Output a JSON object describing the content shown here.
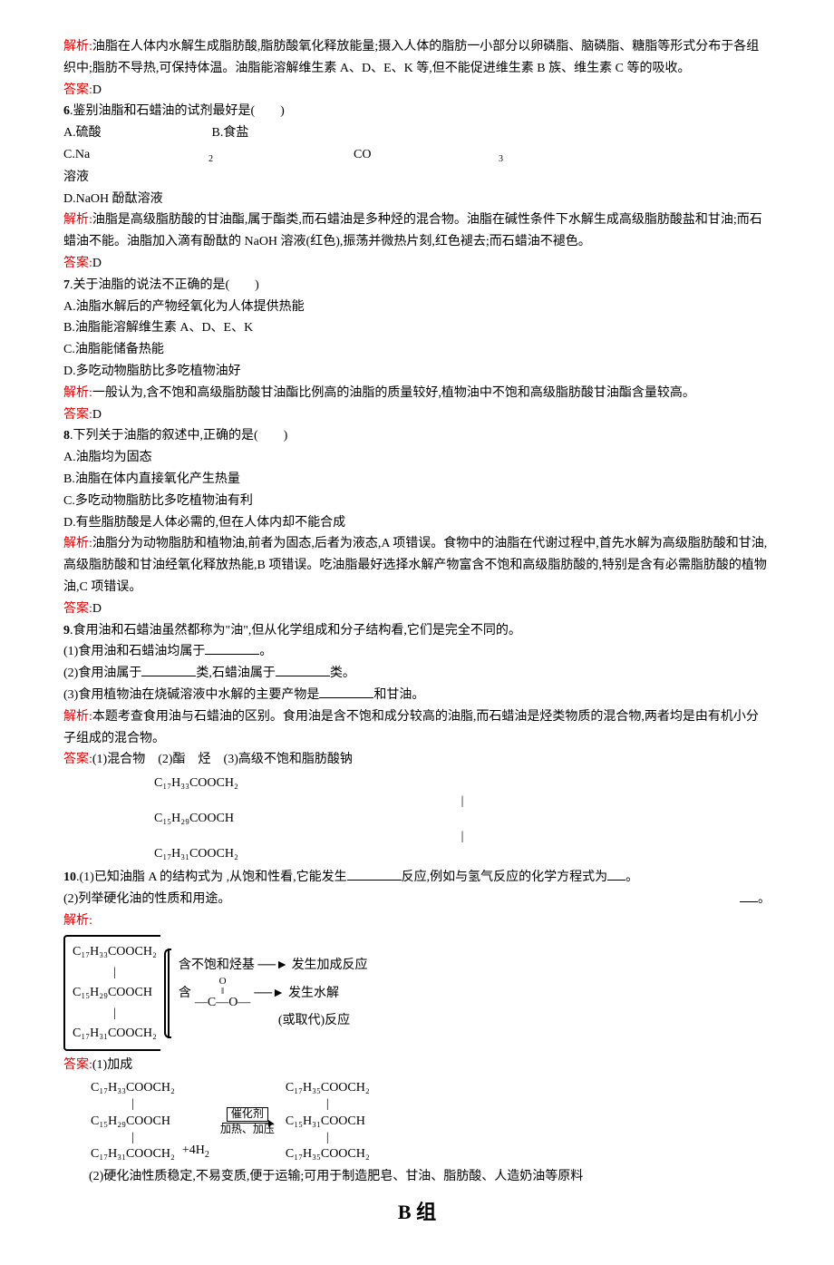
{
  "q5": {
    "jiexi_label": "解析:",
    "jiexi": "油脂在人体内水解生成脂肪酸,脂肪酸氧化释放能量;摄入人体的脂肪一小部分以卵磷脂、脑磷脂、糖脂等形式分布于各组织中;脂肪不导热,可保持体温。油脂能溶解维生素 A、D、E、K 等,但不能促进维生素 B 族、维生素 C 等的吸收。",
    "daan_label": "答案:",
    "daan": "D"
  },
  "q6": {
    "num": "6",
    "stem": ".鉴别油脂和石蜡油的试剂最好是(　　)",
    "optA": "A.硫酸",
    "optB": "B.食盐",
    "optC_pre": "C.Na",
    "optC_sub1": "2",
    "optC_mid": "CO",
    "optC_sub2": "3",
    "optC_post": "溶液",
    "optD": "D.NaOH 酚酞溶液",
    "jiexi_label": "解析:",
    "jiexi": "油脂是高级脂肪酸的甘油酯,属于酯类,而石蜡油是多种烃的混合物。油脂在碱性条件下水解生成高级脂肪酸盐和甘油;而石蜡油不能。油脂加入滴有酚酞的 NaOH 溶液(红色),振荡并微热片刻,红色褪去;而石蜡油不褪色。",
    "daan_label": "答案:",
    "daan": "D"
  },
  "q7": {
    "num": "7",
    "stem": ".关于油脂的说法不正确的是(　　)",
    "optA": "A.油脂水解后的产物经氧化为人体提供热能",
    "optB": "B.油脂能溶解维生素 A、D、E、K",
    "optC": "C.油脂能储备热能",
    "optD": "D.多吃动物脂肪比多吃植物油好",
    "jiexi_label": "解析:",
    "jiexi": "一般认为,含不饱和高级脂肪酸甘油酯比例高的油脂的质量较好,植物油中不饱和高级脂肪酸甘油酯含量较高。",
    "daan_label": "答案:",
    "daan": "D"
  },
  "q8": {
    "num": "8",
    "stem": ".下列关于油脂的叙述中,正确的是(　　)",
    "optA": "A.油脂均为固态",
    "optB": "B.油脂在体内直接氧化产生热量",
    "optC": "C.多吃动物脂肪比多吃植物油有利",
    "optD": "D.有些脂肪酸是人体必需的,但在人体内却不能合成",
    "jiexi_label": "解析:",
    "jiexi": "油脂分为动物脂肪和植物油,前者为固态,后者为液态,A 项错误。食物中的油脂在代谢过程中,首先水解为高级脂肪酸和甘油,高级脂肪酸和甘油经氧化释放热能,B 项错误。吃油脂最好选择水解产物富含不饱和高级脂肪酸的,特别是含有必需脂肪酸的植物油,C 项错误。",
    "daan_label": "答案:",
    "daan": "D"
  },
  "q9": {
    "num": "9",
    "stem": ".食用油和石蜡油虽然都称为\"油\",但从化学组成和分子结构看,它们是完全不同的。",
    "p1a": "(1)食用油和石蜡油均属于",
    "p1b": "。",
    "p2a": "(2)食用油属于",
    "p2b": "类,石蜡油属于",
    "p2c": "类。",
    "p3a": "(3)食用植物油在烧碱溶液中水解的主要产物是",
    "p3b": "和甘油。",
    "jiexi_label": "解析:",
    "jiexi": "本题考查食用油与石蜡油的区别。食用油是含不饱和成分较高的油脂,而石蜡油是烃类物质的混合物,两者均是由有机小分子组成的混合物。",
    "daan_label": "答案:",
    "daan": "(1)混合物　(2)酯　烃　(3)高级不饱和脂肪酸钠"
  },
  "q10": {
    "num": "10",
    "f1": "C₁₇H₃₃COOCH₂",
    "f2": "C₁₅H₂₉COOCH",
    "f3": "C₁₇H₃₁COOCH₂",
    "p1a": ".(1)已知油脂 A 的结构式为",
    "p1b": ",从饱和性看,它能发生",
    "p1c": "反应,例如与氢气反应的化学方程式为",
    "p1d": "。",
    "p2a": "(2)列举硬化油的性质和用途。",
    "p2b": "。",
    "jiexi_label": "解析:",
    "d_l1": "C₁₇H₃₃COOCH₂",
    "d_l2": "C₁₅H₂₉COOCH",
    "d_l3": "C₁₇H₃₁COOCH₂",
    "d_r1": "含不饱和烃基",
    "d_r1b": "发生加成反应",
    "d_r2a": "含",
    "d_r2b": "—C—O—",
    "d_r2c": "发生水解",
    "d_r3": "(或取代)反应",
    "o_top": "O",
    "daan_label": "答案:",
    "daan1": "(1)加成",
    "eq_l1": "C₁₇H₃₃COOCH₂",
    "eq_l2": "C₁₅H₂₉COOCH",
    "eq_l3": "C₁₇H₃₁COOCH₂",
    "eq_plus": "+4H",
    "eq_plus_sub": "2",
    "arrow_top": "催化剂",
    "arrow_bottom": "加热、加压",
    "eq_r1": "C₁₇H₃₅COOCH₂",
    "eq_r2": "C₁₅H₃₁COOCH",
    "eq_r3": "C₁₇H₃₅COOCH₂",
    "daan2": "(2)硬化油性质稳定,不易变质,便于运输;可用于制造肥皂、甘油、脂肪酸、人造奶油等原料"
  },
  "groupB": "B 组"
}
